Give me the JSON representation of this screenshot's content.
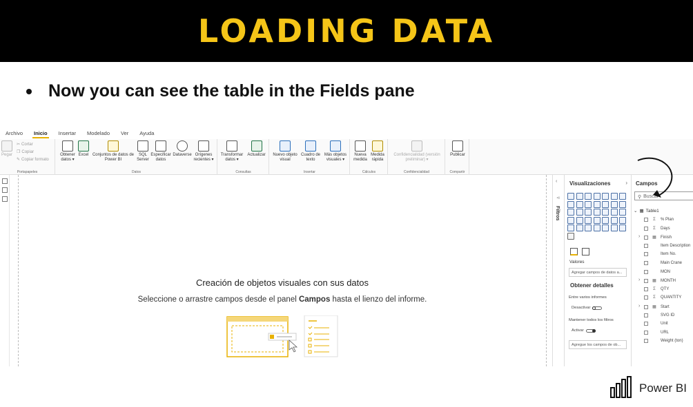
{
  "banner": {
    "title": "LOADING DATA"
  },
  "bullet": {
    "text": "Now you can see the table in the Fields pane"
  },
  "menu": {
    "tabs": [
      "Archivo",
      "Inicio",
      "Insertar",
      "Modelado",
      "Ver",
      "Ayuda"
    ],
    "active": "Inicio"
  },
  "ribbon": {
    "clipboard": {
      "paste": "Pegar",
      "cut": "Cortar",
      "copy": "Copiar",
      "format": "Copiar formato",
      "group": "Portapapeles"
    },
    "data": {
      "buttons": [
        {
          "l1": "Obtener",
          "l2": "datos ▾"
        },
        {
          "l1": "Excel",
          "l2": ""
        },
        {
          "l1": "Conjuntos de datos de",
          "l2": "Power BI"
        },
        {
          "l1": "SQL",
          "l2": "Server"
        },
        {
          "l1": "Especificar",
          "l2": "datos"
        },
        {
          "l1": "Dataverse",
          "l2": ""
        },
        {
          "l1": "Orígenes",
          "l2": "recientes ▾"
        }
      ],
      "group": "Datos"
    },
    "queries": {
      "buttons": [
        {
          "l1": "Transformar",
          "l2": "datos ▾"
        },
        {
          "l1": "Actualizar",
          "l2": ""
        }
      ],
      "group": "Consultas"
    },
    "insert": {
      "buttons": [
        {
          "l1": "Nuevo objeto",
          "l2": "visual"
        },
        {
          "l1": "Cuadro de",
          "l2": "texto"
        },
        {
          "l1": "Más objetos",
          "l2": "visuales ▾"
        }
      ],
      "group": "Insertar"
    },
    "calc": {
      "buttons": [
        {
          "l1": "Nueva",
          "l2": "medida"
        },
        {
          "l1": "Medida",
          "l2": "rápida"
        }
      ],
      "group": "Cálculos"
    },
    "sensitivity": {
      "l1": "Confidencialidad (versión",
      "l2": "preliminar) ▾",
      "group": "Confidencialidad"
    },
    "share": {
      "l1": "Publicar",
      "group": "Compartir"
    }
  },
  "canvas": {
    "title": "Creación de objetos visuales con sus datos",
    "sub_before": "Seleccione o arrastre campos desde el panel ",
    "sub_bold": "Campos",
    "sub_after": " hasta el lienzo del informe."
  },
  "filters": {
    "label": "Filtros"
  },
  "visualizations": {
    "title": "Visualizaciones",
    "values_label": "Valores",
    "values_well": "Agregar campos de datos a...",
    "drill_title": "Obtener detalles",
    "cross_report": "Entre varios informes",
    "off_label": "Desactivar",
    "keep_filters": "Mantener todos los filtros",
    "on_label": "Activar",
    "drill_well": "Agregue los campos de ob..."
  },
  "fields": {
    "title": "Campos",
    "search_placeholder": "Buscar",
    "table_name": "Table1",
    "items": [
      {
        "name": "% Plan",
        "type": "Σ",
        "expand": false
      },
      {
        "name": "Days",
        "type": "Σ",
        "expand": false
      },
      {
        "name": "Finish",
        "type": "cal",
        "expand": true
      },
      {
        "name": "Item Description",
        "type": "",
        "expand": false
      },
      {
        "name": "Item No.",
        "type": "",
        "expand": false
      },
      {
        "name": "Main Crane",
        "type": "",
        "expand": false
      },
      {
        "name": "MON",
        "type": "",
        "expand": false
      },
      {
        "name": "MONTH",
        "type": "cal",
        "expand": true
      },
      {
        "name": "QTY",
        "type": "Σ",
        "expand": false
      },
      {
        "name": "QUANTITY",
        "type": "Σ",
        "expand": false
      },
      {
        "name": "Start",
        "type": "cal",
        "expand": true
      },
      {
        "name": "SVG ID",
        "type": "",
        "expand": false
      },
      {
        "name": "Unit",
        "type": "",
        "expand": false
      },
      {
        "name": "URL",
        "type": "",
        "expand": false
      },
      {
        "name": "Weight (ton)",
        "type": "",
        "expand": false
      }
    ]
  },
  "logo": {
    "text": "Power BI"
  },
  "colors": {
    "banner_bg": "#000000",
    "banner_text": "#f5c518",
    "accent": "#e8b100"
  }
}
